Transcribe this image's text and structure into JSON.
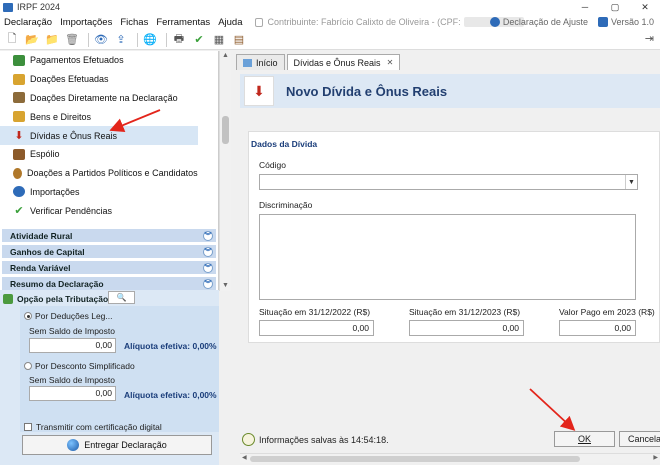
{
  "window": {
    "title": "IRPF 2024",
    "controls": [
      "─",
      "▢",
      "✕"
    ]
  },
  "menubar": {
    "items": [
      "Declaração",
      "Importações",
      "Fichas",
      "Ferramentas",
      "Ajuda"
    ],
    "contributor": "Contribuinte: Fabrício Calixto de Oliveira - (CPF:",
    "declaration_type": "Declaração de Ajuste",
    "version": "Versão 1.0"
  },
  "sidebar": {
    "items": [
      {
        "label": "Pagamentos Efetuados",
        "icon": "card-icon",
        "color": "#3c8f3c"
      },
      {
        "label": "Doações Efetuadas",
        "icon": "gift-icon",
        "color": "#d8a430"
      },
      {
        "label": "Doações Diretamente na Declaração",
        "icon": "people-icon",
        "color": "#8c6b3a"
      },
      {
        "label": "Bens e Direitos",
        "icon": "house-icon",
        "color": "#d8a430"
      },
      {
        "label": "Dívidas e Ônus Reais",
        "icon": "down-arrow-icon",
        "color": "#c0281d"
      },
      {
        "label": "Espólio",
        "icon": "chest-icon",
        "color": "#8c5a2a"
      },
      {
        "label": "Doações a Partidos Políticos e Candidatos",
        "icon": "candidate-icon",
        "color": "#b0782a"
      },
      {
        "label": "Importações",
        "icon": "import-icon",
        "color": "#2e6bb8"
      },
      {
        "label": "Verificar Pendências",
        "icon": "check-icon",
        "color": "#3aa03a"
      }
    ],
    "sections": [
      "Atividade Rural",
      "Ganhos de Capital",
      "Renda Variável",
      "Resumo da Declaração"
    ]
  },
  "opcao": {
    "title": "Opção pela Tributação:",
    "deducoes_label": "Por Deduções Leg...",
    "sem_saldo_1": "Sem Saldo de Imposto",
    "value_1": "0,00",
    "aliquota_1": "Alíquota efetiva: 0,00%",
    "simplificado_label": "Por Desconto Simplificado",
    "sem_saldo_2": "Sem Saldo de Imposto",
    "value_2": "0,00",
    "aliquota_2": "Alíquota efetiva: 0,00%",
    "transmit_label": "Transmitir com certificação digital",
    "entregar_label": "Entregar Declaração"
  },
  "tabs": [
    {
      "label": "Início"
    },
    {
      "label": "Dívidas e Ônus Reais"
    }
  ],
  "form": {
    "banner_title": "Novo Dívida e Ônus Reais",
    "section_title": "Dados da Dívida",
    "codigo_label": "Código",
    "codigo_value": "",
    "discriminacao_label": "Discriminação",
    "discriminacao_value": "",
    "sit2022_label": "Situação em 31/12/2022 (R$)",
    "sit2022_value": "0,00",
    "sit2023_label": "Situação em 31/12/2023 (R$)",
    "sit2023_value": "0,00",
    "pago_label": "Valor Pago em 2023 (R$)",
    "pago_value": "0,00"
  },
  "footer": {
    "status": "Informações salvas às 14:54:18.",
    "ok_label": "OK",
    "cancel_label": "Cancelar"
  },
  "colors": {
    "accent": "#2e6bb8",
    "banner": "#dde8f4",
    "selection": "#d7e6f5",
    "annotation_arrow": "#e3251b"
  }
}
